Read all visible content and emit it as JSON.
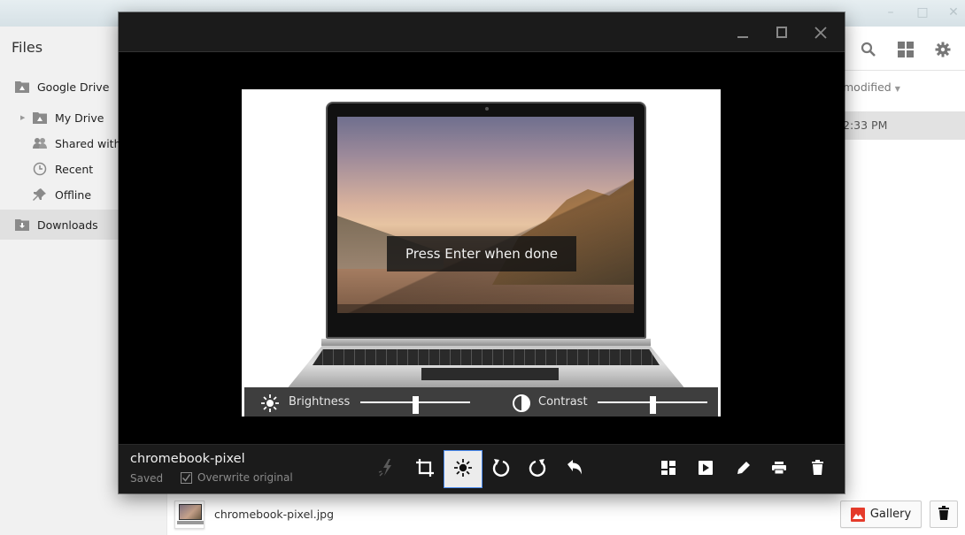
{
  "files_app": {
    "title": "Files",
    "window_controls": {
      "minimize": "–",
      "maximize": "□",
      "close": "✕"
    },
    "sidebar": {
      "items": [
        {
          "label": "Google Drive",
          "icon": "drive-folder-icon",
          "selected": false
        },
        {
          "label": "My Drive",
          "icon": "drive-folder-icon",
          "selected": false,
          "expandable": true
        },
        {
          "label": "Shared with me",
          "visible_label": "Shared with m",
          "icon": "people-icon",
          "selected": false
        },
        {
          "label": "Recent",
          "icon": "clock-icon",
          "selected": false
        },
        {
          "label": "Offline",
          "icon": "pin-icon",
          "selected": false
        },
        {
          "label": "Downloads",
          "icon": "download-folder-icon",
          "selected": true
        }
      ]
    },
    "toolbar": {
      "search": "search-icon",
      "view": "grid-view-icon",
      "settings": "gear-icon"
    },
    "column_header": "modified",
    "selected_row_date": "2:33 PM",
    "bottom_bar": {
      "filename": "chromebook-pixel.jpg",
      "gallery_button": "Gallery",
      "delete_button": "delete-icon"
    }
  },
  "editor": {
    "window_controls": {
      "minimize": "minimize-icon",
      "maximize": "maximize-icon",
      "close": "close-icon"
    },
    "hint": "Press Enter when done",
    "adjust": {
      "brightness_label": "Brightness",
      "brightness_value": 0.5,
      "contrast_label": "Contrast",
      "contrast_value": 0.5
    },
    "footer": {
      "filename": "chromebook-pixel",
      "status": "Saved",
      "overwrite_label": "Overwrite original",
      "overwrite_checked": true,
      "tools": [
        {
          "name": "auto-fix",
          "active": false,
          "disabled": true
        },
        {
          "name": "crop",
          "active": false
        },
        {
          "name": "brightness",
          "active": true
        },
        {
          "name": "rotate-left",
          "active": false
        },
        {
          "name": "rotate-right",
          "active": false
        },
        {
          "name": "undo",
          "active": false
        }
      ],
      "actions": [
        "mosaic-view",
        "slideshow",
        "edit",
        "print",
        "delete"
      ]
    }
  },
  "colors": {
    "accent_blue": "#4a8bf0",
    "gallery_red": "#e53b2b",
    "editor_bar": "#1b1b1b",
    "adjust_bar": "#3e3e3e"
  }
}
